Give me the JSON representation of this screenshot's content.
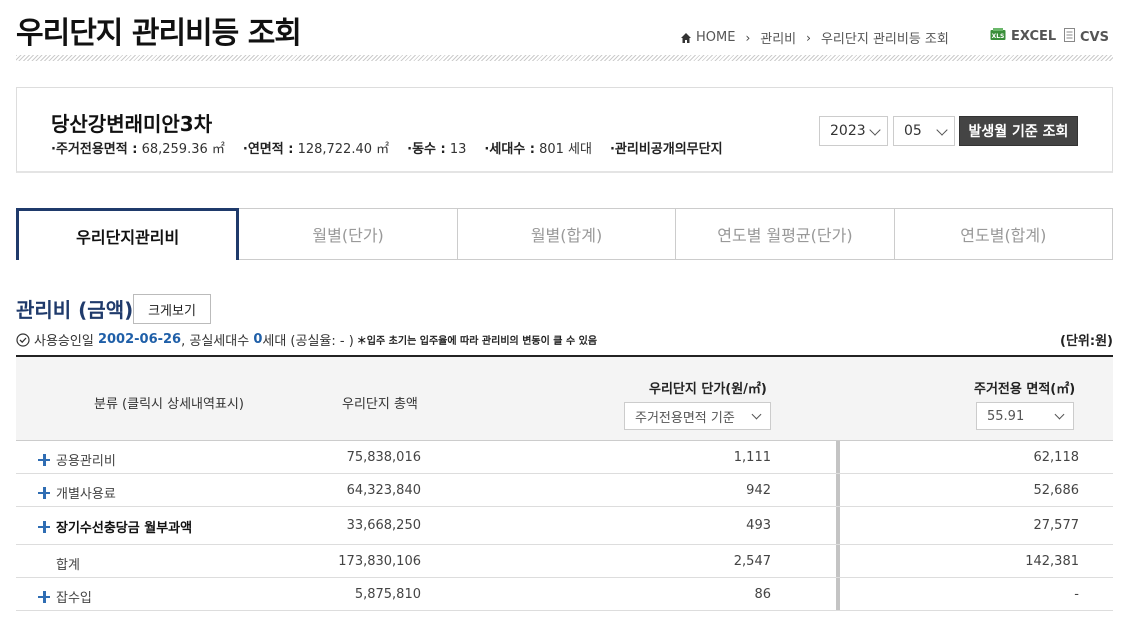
{
  "page": {
    "title": "우리단지 관리비등 조회"
  },
  "breadcrumb": {
    "home": "HOME",
    "level1": "관리비",
    "level2": "우리단지 관리비등 조회"
  },
  "export": {
    "excel": "EXCEL",
    "cvs": "CVS"
  },
  "complex": {
    "name": "당산강변래미안3차",
    "stats": [
      {
        "label": "·주거전용면적 :",
        "value": "68,259.36 ㎡"
      },
      {
        "label": "·연면적 :",
        "value": "128,722.40 ㎡"
      },
      {
        "label": "·동수 :",
        "value": "13"
      },
      {
        "label": "·세대수 :",
        "value": "801 세대"
      },
      {
        "label": "·관리비공개의무단지",
        "value": ""
      }
    ],
    "year": "2023",
    "month": "05",
    "search_button": "발생월 기준 조회"
  },
  "tabs": [
    "우리단지관리비",
    "월별(단가)",
    "월별(합계)",
    "연도별 월평균(단가)",
    "연도별(합계)"
  ],
  "section": {
    "title": "관리비 (금액)",
    "enlarge_button": "크게보기",
    "approval_prefix": "사용승인일",
    "approval_date": "2002-06-26",
    "vacancy_prefix": ", 공실세대수",
    "vacancy_count": "0",
    "vacancy_suffix": "세대 (공실율: - )",
    "note": "＊입주 초기는 입주율에 따라 관리비의 변동이 클 수 있음",
    "unit": "(단위:원)"
  },
  "table": {
    "headers": {
      "category": "분류 (클릭시 상세내역표시)",
      "total": "우리단지 총액",
      "unit_price": "우리단지 단가(원/㎡)",
      "area": "주거전용 면적(㎡)"
    },
    "unit_price_select": "주거전용면적 기준",
    "area_select": "55.91",
    "rows": [
      {
        "category": "공용관리비",
        "total": "75,838,016",
        "unit_price": "1,111",
        "area_amount": "62,118"
      },
      {
        "category": "개별사용료",
        "total": "64,323,840",
        "unit_price": "942",
        "area_amount": "52,686"
      },
      {
        "category": "장기수선충당금 월부과액",
        "total": "33,668,250",
        "unit_price": "493",
        "area_amount": "27,577"
      },
      {
        "category": "합계",
        "total": "173,830,106",
        "unit_price": "2,547",
        "area_amount": "142,381"
      },
      {
        "category": "잡수입",
        "total": "5,875,810",
        "unit_price": "86",
        "area_amount": "-"
      }
    ]
  }
}
